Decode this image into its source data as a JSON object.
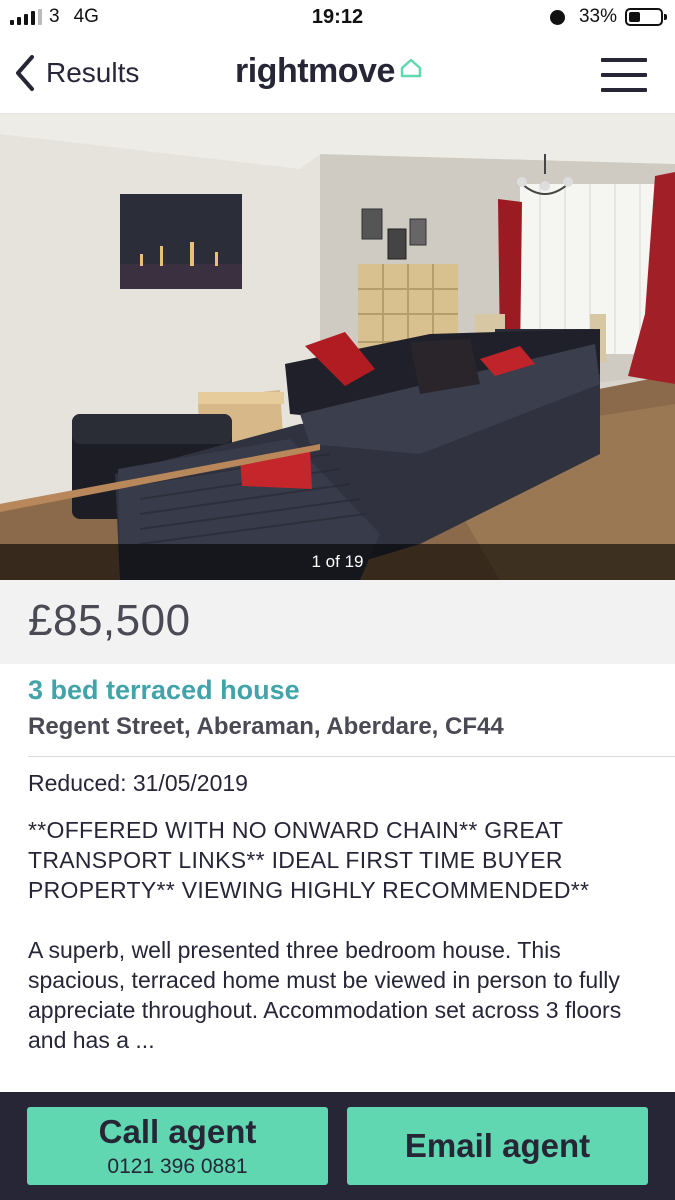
{
  "status_bar": {
    "carrier": "3",
    "network": "4G",
    "time": "19:12",
    "battery": "33%"
  },
  "nav": {
    "back_label": "Results",
    "logo": "rightmove",
    "menu_icon": "hamburger-menu-icon"
  },
  "gallery": {
    "counter": "1 of 19"
  },
  "listing": {
    "price": "£85,500",
    "title": "3 bed terraced house",
    "address": "Regent Street, Aberaman, Aberdare, CF44",
    "reduced": "Reduced: 31/05/2019",
    "headline": "**OFFERED WITH NO ONWARD CHAIN** GREAT TRANSPORT LINKS** IDEAL FIRST TIME BUYER PROPERTY** VIEWING HIGHLY RECOMMENDED**",
    "description": "A superb, well presented three bedroom house. This spacious, terraced home must be viewed in person to fully appreciate throughout. Accommodation set across 3 floors and has a ..."
  },
  "actions": {
    "call_label": "Call agent",
    "call_number": "0121 396 0881",
    "email_label": "Email agent"
  },
  "colors": {
    "brand_dark": "#262637",
    "accent_teal": "#42a4a8",
    "button_green": "#60d7b0",
    "logo_house": "#60d7b0"
  }
}
